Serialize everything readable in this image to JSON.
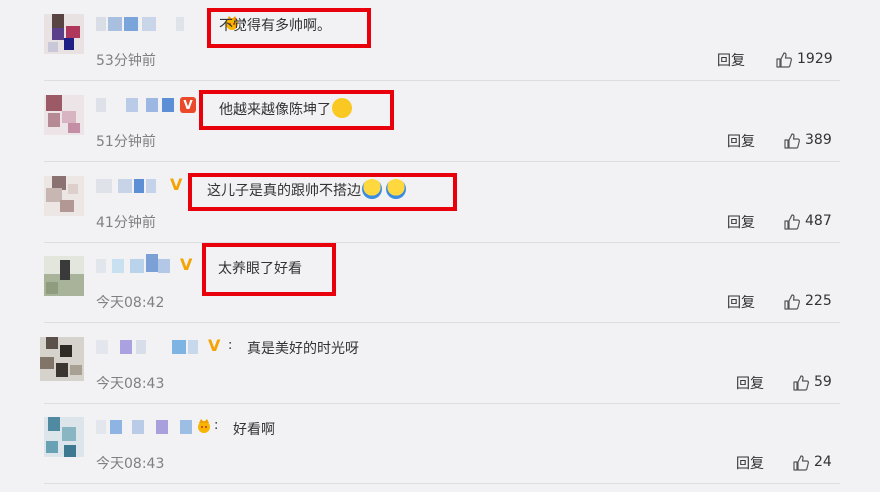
{
  "comments": [
    {
      "text": "不觉得有多帅啊。",
      "time": "53分钟前",
      "reply": "回复",
      "likes": "1929",
      "highlighted": true
    },
    {
      "text": "他越来越像陈坤了",
      "time": "51分钟前",
      "reply": "回复",
      "likes": "389",
      "highlighted": true
    },
    {
      "text": "这儿子是真的跟帅不搭边",
      "time": "41分钟前",
      "reply": "回复",
      "likes": "487",
      "highlighted": true
    },
    {
      "text": "太养眼了好看",
      "time": "今天08:42",
      "reply": "回复",
      "likes": "225",
      "highlighted": true
    },
    {
      "text": "真是美好的时光呀",
      "time": "今天08:43",
      "reply": "回复",
      "likes": "59",
      "highlighted": false
    },
    {
      "text": "好看啊",
      "time": "今天08:43",
      "reply": "回复",
      "likes": "24",
      "highlighted": false
    }
  ],
  "colon": ":",
  "icons": {
    "like": "thumbs-up-icon",
    "vip": "vip-badge-icon",
    "crown": "crown-icon",
    "emoji": "emoji-icon"
  },
  "colors": {
    "highlight": "#e8000b",
    "background": "#f2f2f5",
    "timestamp": "#808080"
  }
}
